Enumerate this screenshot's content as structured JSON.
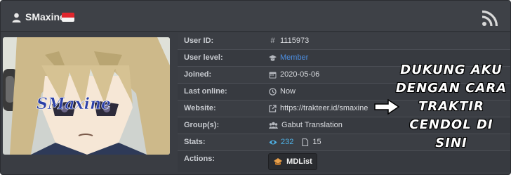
{
  "header": {
    "username": "SMaxine",
    "user_icon": "user-icon",
    "flag_icon": "indonesia-flag-icon",
    "rss_icon": "rss-icon"
  },
  "avatar": {
    "watermark": "SMaxine"
  },
  "rows": {
    "user_id": {
      "label": "User ID:",
      "value": "1115973",
      "icon": "hash-icon"
    },
    "user_level": {
      "label": "User level:",
      "value": "Member",
      "icon": "graduation-cap-icon"
    },
    "joined": {
      "label": "Joined:",
      "value": "2020-05-06",
      "icon": "calendar-icon"
    },
    "last_online": {
      "label": "Last online:",
      "value": "Now",
      "icon": "clock-icon"
    },
    "website": {
      "label": "Website:",
      "value": "https://trakteer.id/smaxine",
      "icon": "external-link-icon"
    },
    "groups": {
      "label": "Group(s):",
      "value": "Gabut Translation",
      "icon": "users-icon"
    },
    "stats": {
      "label": "Stats:",
      "views": "232",
      "files": "15",
      "views_icon": "eye-icon",
      "files_icon": "file-icon"
    },
    "actions": {
      "label": "Actions:",
      "button": "MDList",
      "button_icon": "mdlist-icon"
    }
  },
  "overlay": {
    "line1": "DUKUNG AKU",
    "line2": "DENGAN CARA",
    "line3": "TRAKTIR",
    "line4": "CENDOL DI SINI",
    "arrow_icon": "arrow-right-icon"
  },
  "colors": {
    "background": "#3a3d43",
    "member_link": "#4c8ee0",
    "views_accent": "#4fb3e8",
    "flag_red": "#e0262d",
    "flag_white": "#f4f4f4"
  }
}
